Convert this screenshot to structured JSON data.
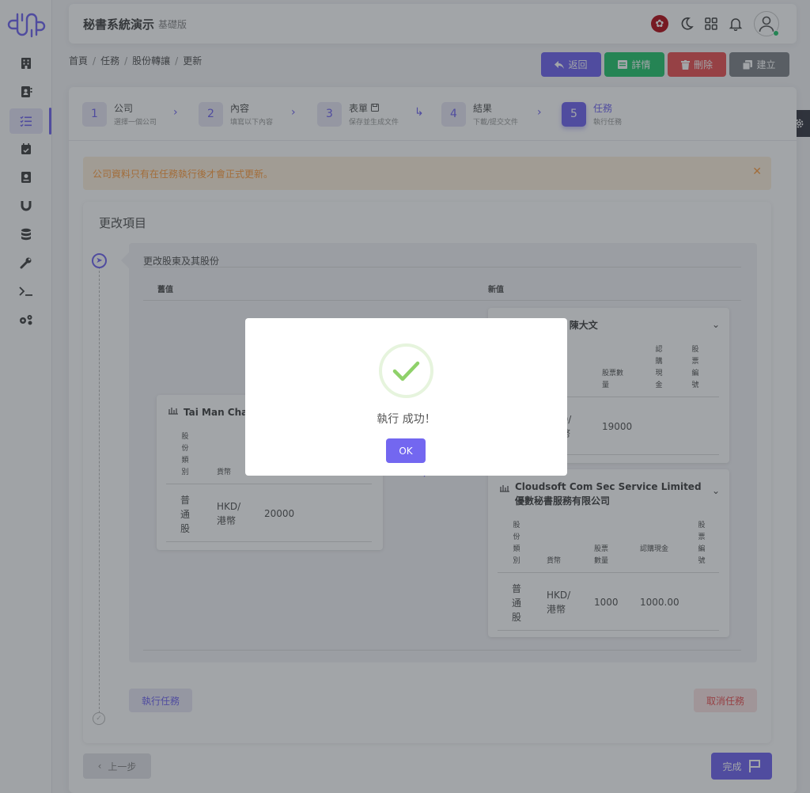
{
  "header": {
    "title": "秘書系統演示",
    "subtitle": "基礎版"
  },
  "breadcrumb": [
    "首頁",
    "任務",
    "股份轉讓",
    "更新"
  ],
  "actions": {
    "back": "返回",
    "detail": "詳情",
    "delete": "刪除",
    "create": "建立"
  },
  "steps": [
    {
      "num": "1",
      "title": "公司",
      "sub": "選擇一個公司"
    },
    {
      "num": "2",
      "title": "內容",
      "sub": "填寫以下內容"
    },
    {
      "num": "3",
      "title": "表單",
      "sub": "保存並生成文件"
    },
    {
      "num": "4",
      "title": "結果",
      "sub": "下載/提交文件"
    },
    {
      "num": "5",
      "title": "任務",
      "sub": "執行任務"
    }
  ],
  "alert": {
    "text": "公司資料只有在任務執行後才會正式更新。",
    "close": "✕"
  },
  "section": {
    "title": "更改項目"
  },
  "change": {
    "title": "更改股東及其股份",
    "old_label": "舊值",
    "new_label": "新值",
    "old_card": {
      "name": "Tai Man Chan",
      "headers": {
        "class": "股份類別",
        "currency": "貨幣"
      },
      "row": {
        "class": "普通股",
        "currency": "HKD/港幣",
        "shares": "20000"
      }
    },
    "new_card1": {
      "name": "n 陳大文",
      "headers": {
        "shares": "股票數量",
        "cash": "認購現金",
        "cert": "股票編號"
      },
      "row": {
        "currency": "D/",
        "currency2": "幣",
        "shares": "19000"
      }
    },
    "new_card2": {
      "name": "Cloudsoft Com Sec Service Limited 優數秘書服務有限公司",
      "headers": {
        "class": "股份類別",
        "currency": "貨幣",
        "shares": "股票數量",
        "cash": "認購現金",
        "cert": "股票編號"
      },
      "row": {
        "class": "普通股",
        "currency": "HKD/港幣",
        "shares": "1000",
        "cash": "1000.00"
      }
    }
  },
  "buttons": {
    "execute": "執行任務",
    "cancel": "取消任務",
    "prev": "上一步",
    "finish": "完成"
  },
  "modal": {
    "message": "執行 成功！",
    "ok": "OK"
  },
  "colors": {
    "primary": "#7367f0",
    "success": "#28c76f",
    "danger": "#ea5455",
    "warning": "#ff9f43",
    "secondary": "#82868b"
  }
}
